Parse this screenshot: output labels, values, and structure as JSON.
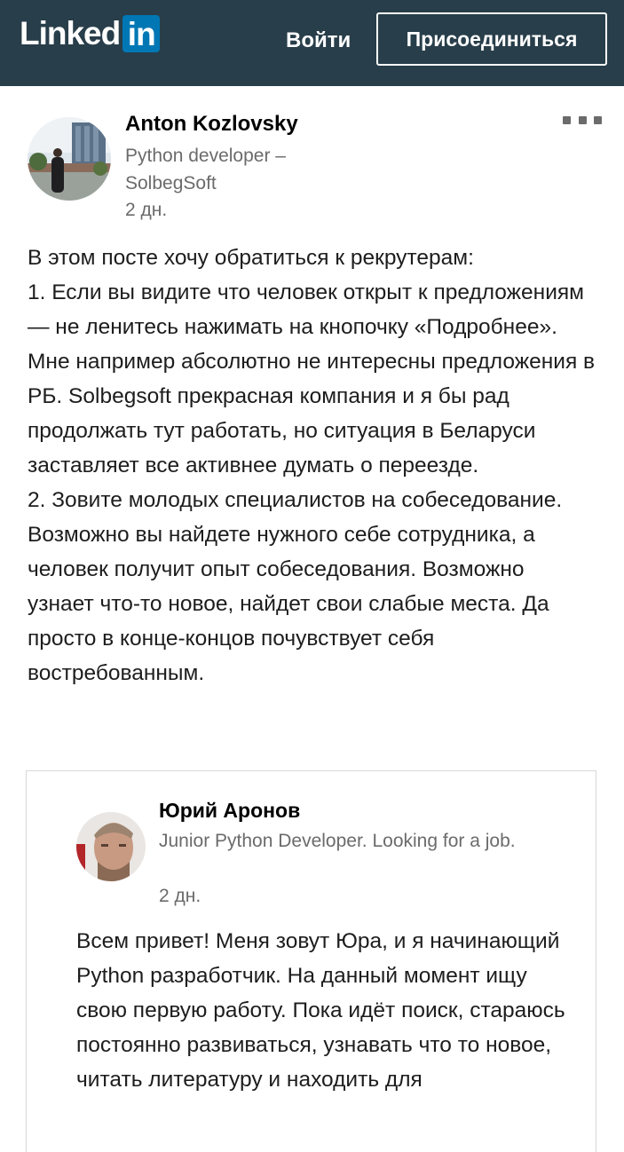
{
  "header": {
    "logo_text": "Linked",
    "logo_box": "in",
    "signin_label": "Войти",
    "join_label": "Присоединиться"
  },
  "post": {
    "author_name": "Anton Kozlovsky",
    "author_headline": "Python developer – SolbegSoft",
    "time": "2 дн.",
    "more_icon": "ellipsis-icon",
    "text": "В этом посте хочу обратиться к рекрутерам:\n1. Если вы видите что человек открыт к предложениям — не ленитесь нажимать на кнопочку «Подробнее». Мне например абсолютно не интересны предложения в РБ. Solbegsoft прекрасная компания и я бы рад продолжать тут работать, но ситуация в Беларуси заставляет все активнее думать о переезде.\n2. Зовите молодых специалистов на собеседование. Возможно вы найдете нужного себе сотрудника, а человек получит опыт собеседования. Возможно узнает что-то новое, найдет свои слабые места. Да просто в конце-концов почувствует себя востребованным."
  },
  "shared_post": {
    "author_name": "Юрий Аронов",
    "author_headline": "Junior Python Developer. Looking for a job.",
    "time": "2 дн.",
    "text": "Всем привет! Меня зовут Юра, и я начинающий Python разработчик. На данный момент ищу свою первую работу. Пока идёт поиск, стараюсь постоянно развиваться, узнавать что то новое, читать литературу и находить для"
  },
  "colors": {
    "header_bg": "#283e4a",
    "brand_blue": "#0077b5",
    "secondary_text": "#6b6b6b"
  }
}
